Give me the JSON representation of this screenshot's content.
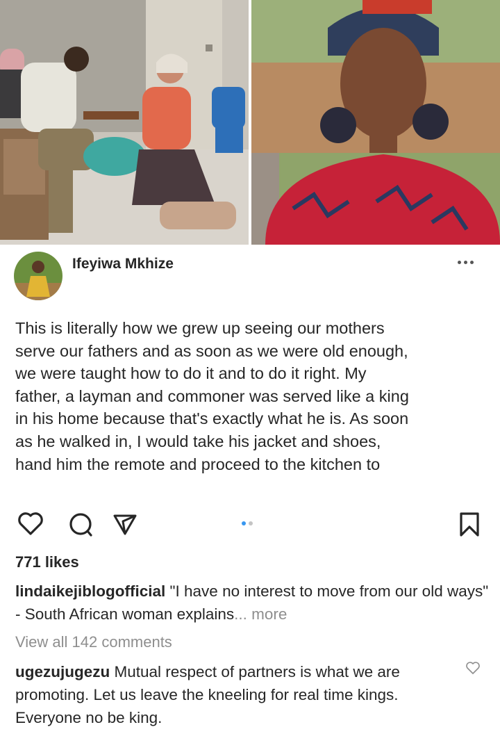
{
  "post": {
    "username": "Ifeyiwa Mkhize",
    "text_lines": [
      "This is literally how we grew up seeing our mothers",
      "serve our fathers and as soon as we were old enough,",
      "we were taught how to do it and to do it right. My",
      "father, a layman and commoner was served like a king",
      "in his home because that's exactly what he is. As soon",
      "as he walked in, I would take his jacket and shoes,",
      "hand him the remote and proceed to the kitchen to"
    ],
    "likes": "771 likes",
    "caption": {
      "username": "lindaikejiblogofficial",
      "text": " \"I have no interest to move from our old ways\" - South African woman explains",
      "more": "... more"
    },
    "view_comments": "View all 142 comments",
    "comment": {
      "username": "ugezujugezu",
      "text": " Mutual respect of partners is what we are promoting. Let us leave the kneeling for real time kings. Everyone no be king."
    }
  },
  "icons": {
    "like": "heart-icon",
    "comment": "comment-bubble-icon",
    "share": "paper-plane-icon",
    "save": "bookmark-icon",
    "more": "more-dots-icon"
  },
  "carousel": {
    "current": 1,
    "total": 2
  },
  "colors": {
    "active_dot": "#3897f0",
    "inactive_dot": "#c4c4c4",
    "muted_text": "#8e8e8e"
  }
}
